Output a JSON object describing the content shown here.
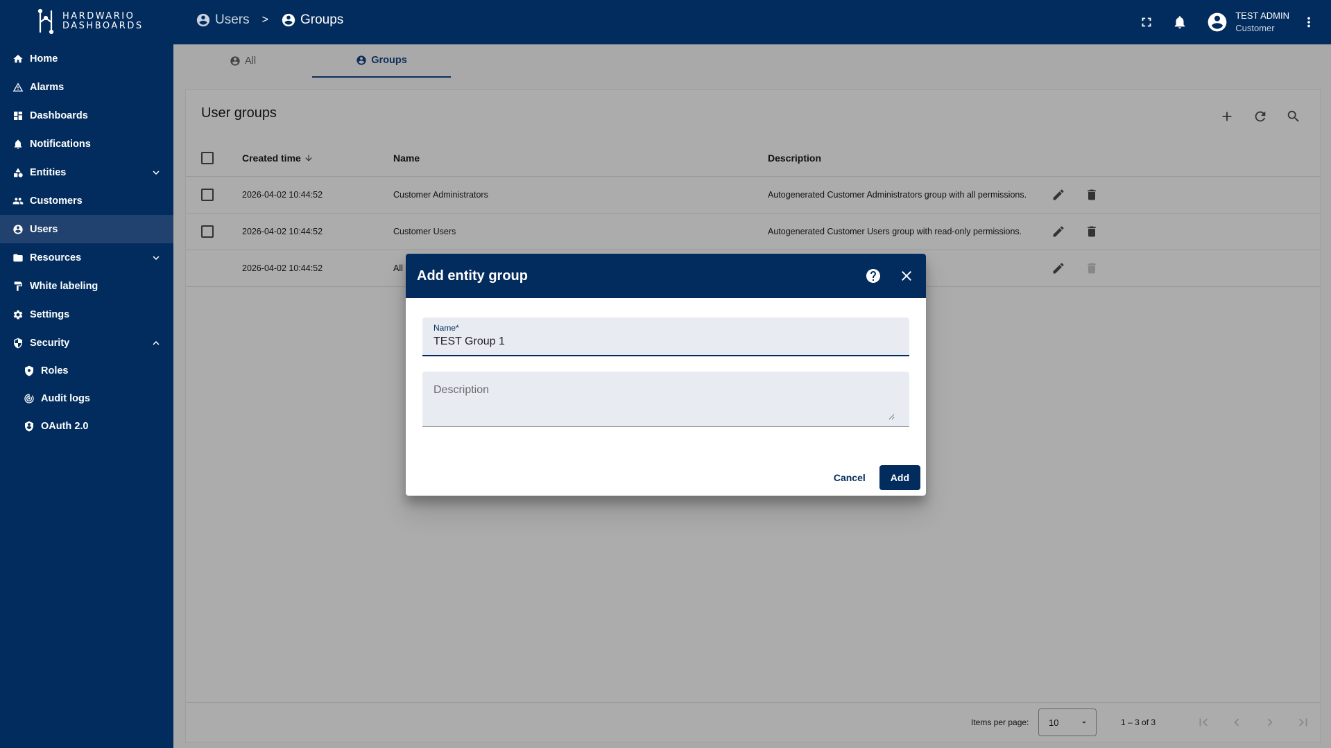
{
  "app": {
    "logo_line1": "HARDWARIO",
    "logo_line2": "DASHBOARDS"
  },
  "breadcrumb": {
    "items": [
      "Users",
      "Groups"
    ],
    "separator": ">"
  },
  "user": {
    "name": "TEST ADMIN",
    "role": "Customer"
  },
  "sidebar": {
    "items": [
      {
        "label": "Home",
        "icon": "home-icon"
      },
      {
        "label": "Alarms",
        "icon": "warning-icon"
      },
      {
        "label": "Dashboards",
        "icon": "dashboard-icon"
      },
      {
        "label": "Notifications",
        "icon": "notification-icon"
      },
      {
        "label": "Entities",
        "icon": "shapes-icon",
        "expandable": true
      },
      {
        "label": "Customers",
        "icon": "people-icon"
      },
      {
        "label": "Users",
        "icon": "account-circle-icon",
        "active": true
      },
      {
        "label": "Resources",
        "icon": "folder-icon",
        "expandable": true
      },
      {
        "label": "White labeling",
        "icon": "paint-roller-icon"
      },
      {
        "label": "Settings",
        "icon": "gear-icon"
      },
      {
        "label": "Security",
        "icon": "shield-icon",
        "expanded": true
      }
    ],
    "security_sub": [
      {
        "label": "Roles",
        "icon": "shield-gear-icon"
      },
      {
        "label": "Audit logs",
        "icon": "track-changes-icon"
      },
      {
        "label": "OAuth 2.0",
        "icon": "security-account-icon"
      }
    ]
  },
  "tabs": [
    {
      "label": "All",
      "active": false
    },
    {
      "label": "Groups",
      "active": true
    }
  ],
  "card": {
    "title": "User groups",
    "columns": {
      "created": "Created time",
      "name": "Name",
      "description": "Description"
    },
    "rows": [
      {
        "created": "2026-04-02 10:44:52",
        "name": "Customer Administrators",
        "description": "Autogenerated Customer Administrators group with all permissions.",
        "checkbox": true
      },
      {
        "created": "2026-04-02 10:44:52",
        "name": "Customer Users",
        "description": "Autogenerated Customer Users group with read-only permissions.",
        "checkbox": true
      },
      {
        "created": "2026-04-02 10:44:52",
        "name": "All",
        "description": "",
        "checkbox": false
      }
    ]
  },
  "paginator": {
    "items_per_page_label": "Items per page:",
    "page_size": "10",
    "range": "1 – 3 of 3"
  },
  "dialog": {
    "title": "Add entity group",
    "name_label": "Name*",
    "name_value": "TEST Group 1",
    "description_placeholder": "Description",
    "cancel_label": "Cancel",
    "add_label": "Add"
  },
  "colors": {
    "brand": "#022c5d",
    "overlay_background": "#a9a9a9",
    "dialog_field": "#e8ecf2"
  }
}
